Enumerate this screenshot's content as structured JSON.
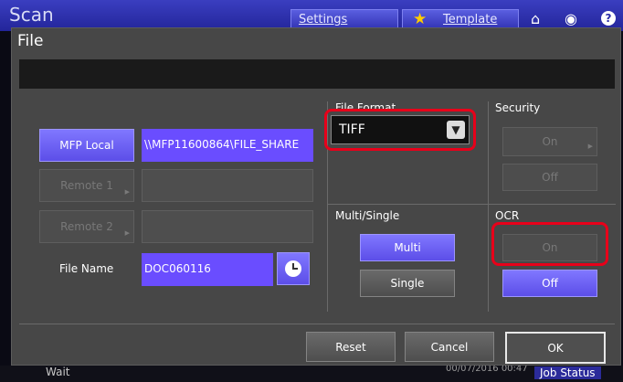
{
  "app": {
    "title": "Scan",
    "settings_label": "Settings",
    "template_label": "Template",
    "status_text": "Wait",
    "datetime": "00/07/2016 00:47",
    "job_status_label": "Job Status"
  },
  "dialog": {
    "title": "File",
    "left": {
      "mfp_local_label": "MFP Local",
      "mfp_local_path": "\\\\MFP11600864\\FILE_SHARE",
      "remote1_label": "Remote 1",
      "remote1_path": "",
      "remote2_label": "Remote 2",
      "remote2_path": "",
      "file_name_label": "File Name",
      "file_name_value": "DOC060116"
    },
    "file_format": {
      "label": "File Format",
      "selected": "TIFF"
    },
    "multi_single": {
      "label": "Multi/Single",
      "multi_label": "Multi",
      "single_label": "Single"
    },
    "security": {
      "label": "Security",
      "on_label": "On",
      "off_label": "Off"
    },
    "ocr": {
      "label": "OCR",
      "on_label": "On",
      "off_label": "Off"
    },
    "footer": {
      "reset_label": "Reset",
      "cancel_label": "Cancel",
      "ok_label": "OK"
    }
  },
  "colors": {
    "accent": "#6a4dff",
    "highlight": "#e8001a",
    "topbar": "#2a2da8"
  },
  "icons": {
    "home": "home-icon",
    "globe": "globe-icon",
    "help": "help-icon",
    "template": "star-icon",
    "time": "clock-icon"
  }
}
